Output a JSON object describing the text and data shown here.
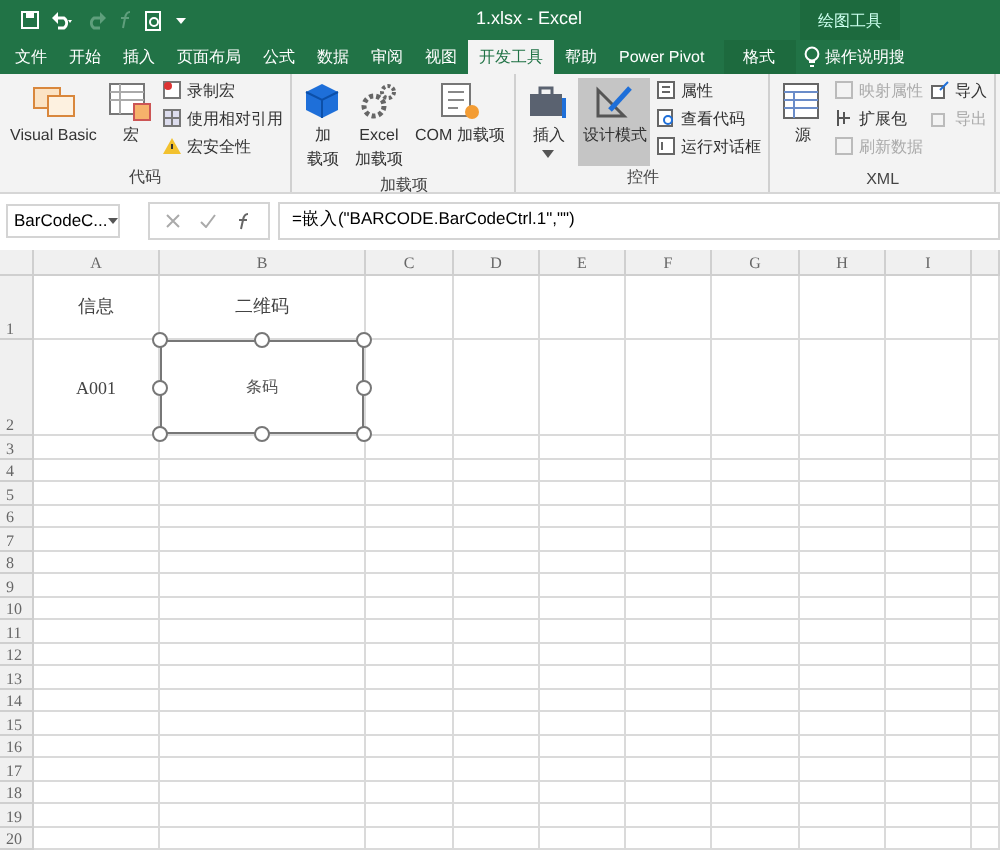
{
  "window": {
    "title": "1.xlsx  -  Excel",
    "contextual_group": "绘图工具"
  },
  "tabs": [
    {
      "label": "文件",
      "selected": false,
      "kind": "normal"
    },
    {
      "label": "开始",
      "selected": false,
      "kind": "normal"
    },
    {
      "label": "插入",
      "selected": false,
      "kind": "normal"
    },
    {
      "label": "页面布局",
      "selected": false,
      "kind": "normal"
    },
    {
      "label": "公式",
      "selected": false,
      "kind": "normal"
    },
    {
      "label": "数据",
      "selected": false,
      "kind": "normal"
    },
    {
      "label": "审阅",
      "selected": false,
      "kind": "normal"
    },
    {
      "label": "视图",
      "selected": false,
      "kind": "normal"
    },
    {
      "label": "开发工具",
      "selected": true,
      "kind": "normal"
    },
    {
      "label": "帮助",
      "selected": false,
      "kind": "normal"
    },
    {
      "label": "Power Pivot",
      "selected": false,
      "kind": "normal"
    },
    {
      "label": "格式",
      "selected": false,
      "kind": "contextual"
    }
  ],
  "tell_me": "操作说明搜",
  "ribbon_groups": [
    {
      "label": "代码",
      "commands": [
        {
          "kind": "large",
          "lines": [
            "Visual Basic"
          ]
        },
        {
          "kind": "large",
          "lines": [
            "宏"
          ]
        },
        {
          "kind": "small",
          "label": "录制宏",
          "disabled": false
        },
        {
          "kind": "small",
          "label": "使用相对引用",
          "disabled": false
        },
        {
          "kind": "small",
          "label": "宏安全性",
          "disabled": false
        }
      ]
    },
    {
      "label": "加载项",
      "commands": [
        {
          "kind": "large",
          "lines": [
            "加",
            "载项"
          ]
        },
        {
          "kind": "large",
          "lines": [
            "Excel",
            "加载项"
          ]
        },
        {
          "kind": "large",
          "lines": [
            "COM 加载项"
          ]
        }
      ]
    },
    {
      "label": "控件",
      "commands": [
        {
          "kind": "large",
          "lines": [
            "插入"
          ],
          "dropdown": true
        },
        {
          "kind": "large",
          "lines": [
            "设计模式"
          ],
          "on": true
        },
        {
          "kind": "small",
          "label": "属性",
          "disabled": false
        },
        {
          "kind": "small",
          "label": "查看代码",
          "disabled": false
        },
        {
          "kind": "small",
          "label": "运行对话框",
          "disabled": false
        }
      ]
    },
    {
      "label": "XML",
      "commands": [
        {
          "kind": "large",
          "lines": [
            "源"
          ]
        },
        {
          "kind": "small",
          "label": "映射属性",
          "disabled": true
        },
        {
          "kind": "small",
          "label": "扩展包",
          "disabled": false
        },
        {
          "kind": "small",
          "label": "刷新数据",
          "disabled": true
        },
        {
          "kind": "small",
          "label": "导入",
          "disabled": false
        },
        {
          "kind": "small",
          "label": "导出",
          "disabled": true
        }
      ]
    }
  ],
  "name_box": "BarCodeC...",
  "formula": "=嵌入(\"BARCODE.BarCodeCtrl.1\",\"\")",
  "columns": [
    "A",
    "B",
    "C",
    "D",
    "E",
    "F",
    "G",
    "H",
    "I"
  ],
  "rows": [
    {
      "header": "1",
      "cells": [
        "信息",
        "二维码"
      ]
    },
    {
      "header": "2",
      "cells": [
        "A001"
      ]
    },
    {
      "header": "3"
    },
    {
      "header": "4"
    },
    {
      "header": "5"
    },
    {
      "header": "6"
    },
    {
      "header": "7"
    },
    {
      "header": "8"
    },
    {
      "header": "9"
    },
    {
      "header": "10"
    },
    {
      "header": "11"
    },
    {
      "header": "12"
    },
    {
      "header": "13"
    },
    {
      "header": "14"
    },
    {
      "header": "15"
    },
    {
      "header": "16"
    },
    {
      "header": "17"
    },
    {
      "header": "18"
    },
    {
      "header": "19"
    },
    {
      "header": "20"
    }
  ],
  "control": {
    "text": "条码",
    "selected": true
  }
}
